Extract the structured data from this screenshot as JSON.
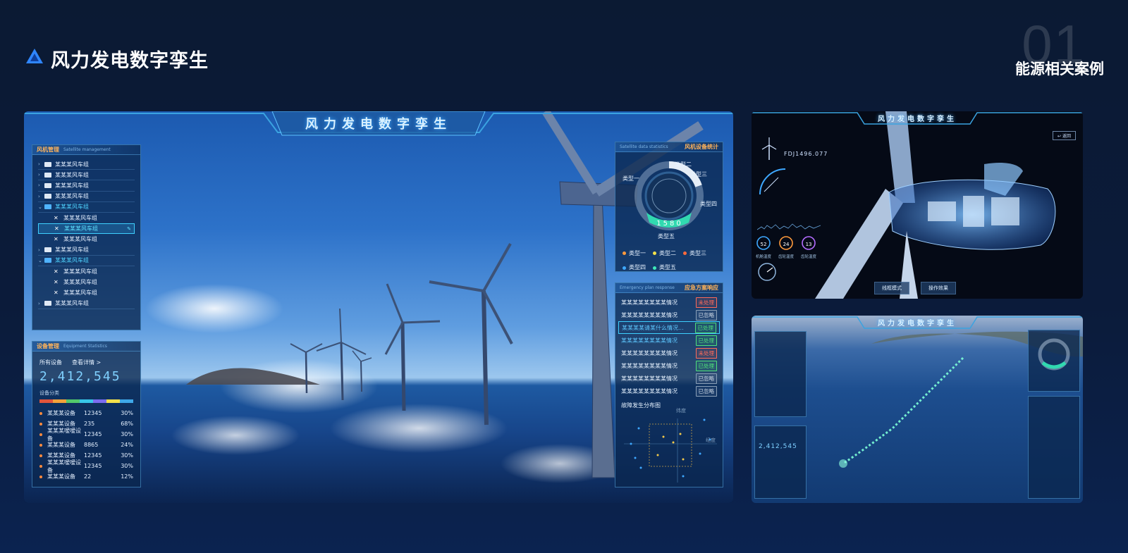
{
  "page": {
    "title": "风力发电数字孪生",
    "section_number": "01",
    "section_label": "能源相关案例"
  },
  "main_screen": {
    "title": "风力发电数字孪生",
    "tree_panel": {
      "title": "风机管理",
      "subtitle": "Satellite management",
      "items": [
        {
          "label": "某某某风车组",
          "level": 0,
          "expanded": false
        },
        {
          "label": "某某某风车组",
          "level": 0,
          "expanded": false
        },
        {
          "label": "某某某风车组",
          "level": 0,
          "expanded": false
        },
        {
          "label": "某某某风车组",
          "level": 0,
          "expanded": false
        },
        {
          "label": "某某某风车组",
          "level": 0,
          "expanded": true
        },
        {
          "label": "某某某风车组",
          "level": 1
        },
        {
          "label": "某某某风车组",
          "level": 1,
          "selected": true
        },
        {
          "label": "某某某风车组",
          "level": 1
        },
        {
          "label": "某某某风车组",
          "level": 0,
          "expanded": false
        },
        {
          "label": "某某某风车组",
          "level": 0,
          "expanded": true
        },
        {
          "label": "某某某风车组",
          "level": 1
        },
        {
          "label": "某某某风车组",
          "level": 1
        },
        {
          "label": "某某某风车组",
          "level": 1
        },
        {
          "label": "某某某风车组",
          "level": 0,
          "expanded": false
        }
      ]
    },
    "equipment_panel": {
      "title": "设备管理",
      "subtitle": "Equipment Statistics",
      "all_label": "所有设备",
      "detail_link": "查看详情 >",
      "total": "2,412,545",
      "category_label": "设备分类",
      "category_colors": [
        "#e2553b",
        "#f2a23a",
        "#52c96b",
        "#38c7e8",
        "#7b6cf0",
        "#f3e04a",
        "#3ea8e8"
      ],
      "rows": [
        {
          "name": "某某某设备",
          "count": "12345",
          "pct": "30%"
        },
        {
          "name": "某某某设备",
          "count": "235",
          "pct": "68%"
        },
        {
          "name": "某某某嗳嗳设备",
          "count": "12345",
          "pct": "30%"
        },
        {
          "name": "某某某设备",
          "count": "8865",
          "pct": "24%"
        },
        {
          "name": "某某某设备",
          "count": "12345",
          "pct": "30%"
        },
        {
          "name": "某某某嗳嗳设备",
          "count": "12345",
          "pct": "30%"
        },
        {
          "name": "某某某设备",
          "count": "22",
          "pct": "12%"
        }
      ]
    },
    "stats_panel": {
      "title": "风机设备统计",
      "subtitle": "Satellite data statistics",
      "center_value": "1580",
      "ring_labels": [
        "类型一",
        "类型二",
        "类型三",
        "类型四",
        "类型五"
      ],
      "legend": [
        {
          "label": "类型一",
          "color": "#ff9a3c"
        },
        {
          "label": "类型二",
          "color": "#f3e04a"
        },
        {
          "label": "类型三",
          "color": "#ff6a3c"
        },
        {
          "label": "类型四",
          "color": "#3ea8ff"
        },
        {
          "label": "类型五",
          "color": "#3ee8b8"
        }
      ]
    },
    "emergency_panel": {
      "title": "应急方案响应",
      "subtitle": "Emergency plan response",
      "rows": [
        {
          "text": "某某某某某某某某情况",
          "status": "未处理",
          "kind": "red"
        },
        {
          "text": "某某某某某某某某情况",
          "status": "已忽略",
          "kind": "gray"
        },
        {
          "text": "某某某某请某什么情况...",
          "status": "已处理",
          "kind": "green",
          "highlight": true
        },
        {
          "text": "某某某某某某某某情况",
          "status": "已处理",
          "kind": "green"
        },
        {
          "text": "某某某某某某某某情况",
          "status": "未处理",
          "kind": "red"
        },
        {
          "text": "某某某某某某某某情况",
          "status": "已处理",
          "kind": "green"
        },
        {
          "text": "某某某某某某某某情况",
          "status": "已忽略",
          "kind": "gray"
        },
        {
          "text": "某某某某某某某某情况",
          "status": "已忽略",
          "kind": "gray"
        }
      ],
      "distribution_title": "故障发生分布图",
      "axis_lat": "纬度",
      "axis_lon": "经度"
    }
  },
  "detail_screen": {
    "title": "风力发电数字孪生",
    "back_label": "返回",
    "device_code": "FDJ1496.077",
    "gauges": [
      {
        "value": "52",
        "label": "机舱温度",
        "color": "#3ea8ff"
      },
      {
        "value": "24",
        "label": "齿轮温度",
        "color": "#ff9a3c"
      },
      {
        "value": "13",
        "label": "齿轮温度",
        "color": "#b46cff"
      }
    ],
    "buttons": [
      "线框模式",
      "操作效果"
    ]
  },
  "ocean_screen": {
    "title": "风力发电数字孪生",
    "total": "2,412,545"
  }
}
